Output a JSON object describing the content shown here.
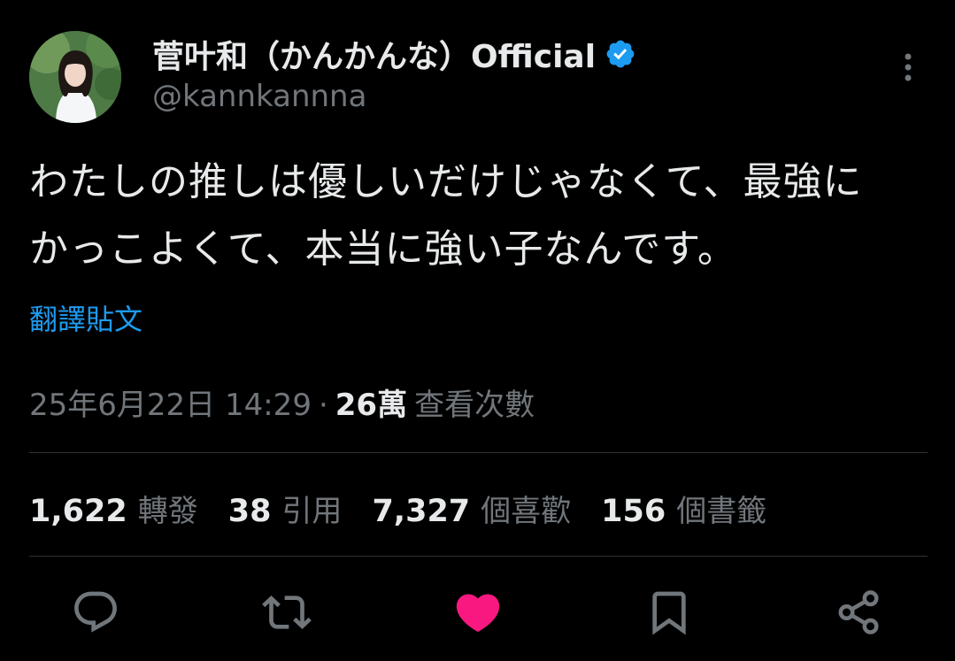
{
  "colors": {
    "background": "#000000",
    "primary_text": "#e7e9ea",
    "secondary_text": "#71767b",
    "accent_blue": "#1d9bf0",
    "like_pink": "#f91880",
    "divider": "#2f3336"
  },
  "author": {
    "display_name": "菅叶和（かんかんな）Official",
    "handle": "@kannkannna",
    "verified_icon": "verified-badge-icon",
    "avatar_icon": "avatar"
  },
  "tweet": {
    "text_lines": [
      "わたしの推しは優しいだけじゃなくて、最強に",
      "かっこよくて、本当に強い子なんです。"
    ],
    "translate_label": "翻譯貼文",
    "timestamp": "25年6月22日 14:29",
    "separator": "·",
    "views_count": "26萬",
    "views_label": "查看次數"
  },
  "stats": [
    {
      "value": "1,622",
      "label": "轉發"
    },
    {
      "value": "38",
      "label": "引用"
    },
    {
      "value": "7,327",
      "label": "個喜歡"
    },
    {
      "value": "156",
      "label": "個書籤"
    }
  ],
  "actions": [
    {
      "name": "reply",
      "icon": "reply-icon"
    },
    {
      "name": "retweet",
      "icon": "retweet-icon"
    },
    {
      "name": "like",
      "icon": "heart-icon",
      "active": true
    },
    {
      "name": "bookmark",
      "icon": "bookmark-icon"
    },
    {
      "name": "share",
      "icon": "share-icon"
    }
  ]
}
